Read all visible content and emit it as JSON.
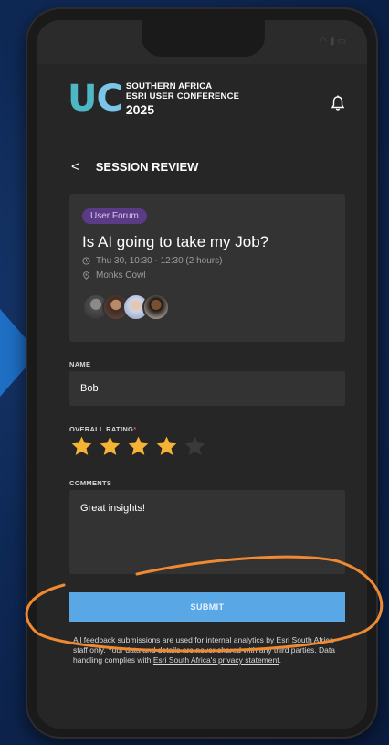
{
  "conference": {
    "logo_letters": "UC",
    "line1": "SOUTHERN AFRICA",
    "line2": "ESRI USER CONFERENCE",
    "year": "2025"
  },
  "header": {
    "back_label": "<",
    "title": "SESSION REVIEW"
  },
  "session": {
    "badge": "User Forum",
    "title": "Is AI going to take my Job?",
    "time": "Thu 30, 10:30 - 12:30 (2 hours)",
    "location": "Monks Cowl",
    "speaker_count": 4
  },
  "form": {
    "name_label": "NAME",
    "name_value": "Bob",
    "rating_label": "OVERALL RATING",
    "rating_required_mark": "*",
    "rating_value": 4,
    "rating_max": 5,
    "comments_label": "COMMENTS",
    "comments_value": "Great insights!",
    "submit_label": "SUBMIT"
  },
  "disclaimer": {
    "text": "All feedback submissions are used for internal analytics by Esri South Africa staff only. Your data and details are never shared with any third parties. Data handling complies with ",
    "link_text": "Esri South Africa's privacy statement",
    "end": "."
  },
  "colors": {
    "accent_blue": "#5aa7e6",
    "star_gold": "#f5b335",
    "star_empty": "#3a3a3a",
    "badge_purple": "#5b3b86",
    "annotation_orange": "#f08a32"
  },
  "icons": [
    "bell-icon",
    "clock-icon",
    "location-icon",
    "star-icon"
  ]
}
